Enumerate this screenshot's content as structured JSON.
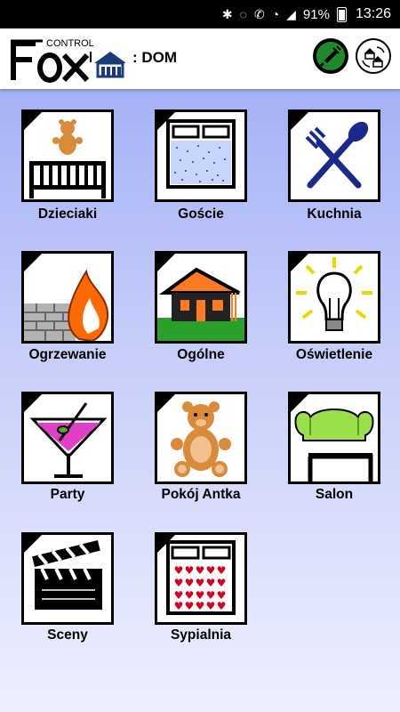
{
  "status": {
    "battery": "91%",
    "time": "13:26"
  },
  "header": {
    "logo_text": "FOX",
    "logo_sub": "CONTROL",
    "location": ": DOM"
  },
  "rooms": [
    {
      "label": "Dzieciaki",
      "icon": "crib-teddy-icon"
    },
    {
      "label": "Goście",
      "icon": "bed-icon"
    },
    {
      "label": "Kuchnia",
      "icon": "fork-spoon-icon"
    },
    {
      "label": "Ogrzewanie",
      "icon": "fire-wall-icon"
    },
    {
      "label": "Ogólne",
      "icon": "house-icon"
    },
    {
      "label": "Oświetlenie",
      "icon": "lightbulb-icon"
    },
    {
      "label": "Party",
      "icon": "cocktail-icon"
    },
    {
      "label": "Pokój Antka",
      "icon": "teddy-bear-icon"
    },
    {
      "label": "Salon",
      "icon": "sofa-table-icon"
    },
    {
      "label": "Sceny",
      "icon": "clapperboard-icon"
    },
    {
      "label": "Sypialnia",
      "icon": "heart-bed-icon"
    }
  ]
}
